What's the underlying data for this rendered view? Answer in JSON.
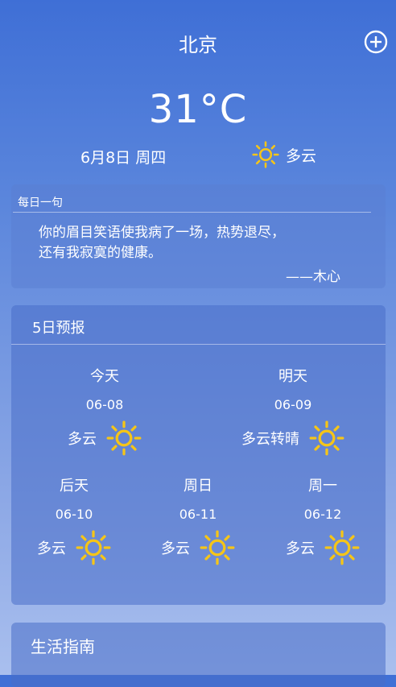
{
  "header": {
    "city": "北京"
  },
  "current": {
    "temperature": "31°C",
    "date": "6月8日 周四",
    "condition": "多云",
    "icon": "sun-icon"
  },
  "quote": {
    "title": "每日一句",
    "line1": "你的眉目笑语使我病了一场，热势退尽，",
    "line2": "还有我寂寞的健康。",
    "author": "——木心"
  },
  "forecast": {
    "title": "5日预报",
    "days": [
      {
        "name": "今天",
        "date": "06-08",
        "condition": "多云"
      },
      {
        "name": "明天",
        "date": "06-09",
        "condition": "多云转晴"
      },
      {
        "name": "后天",
        "date": "06-10",
        "condition": "多云"
      },
      {
        "name": "周日",
        "date": "06-11",
        "condition": "多云"
      },
      {
        "name": "周一",
        "date": "06-12",
        "condition": "多云"
      }
    ]
  },
  "life": {
    "title": "生活指南"
  },
  "colors": {
    "sun": "#f5c518",
    "card": "#486ec8"
  }
}
